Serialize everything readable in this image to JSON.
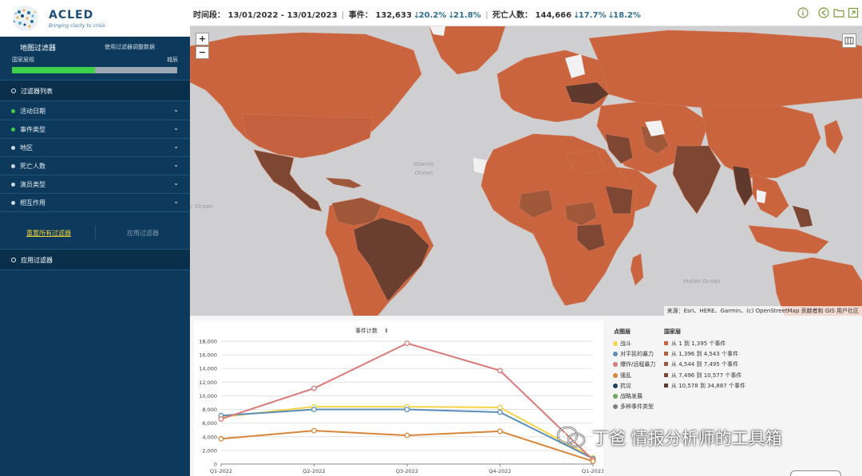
{
  "brand": {
    "name": "ACLED",
    "tagline": "Bringing clarity to crisis"
  },
  "sidebar": {
    "map_filter_title": "地图过滤器",
    "map_filter_use": "使用过滤器调整数据",
    "level_left": "国家层规",
    "level_right": "城辰",
    "level_progress": 0.5,
    "filter_list_title": "过滤器列表",
    "filters": [
      {
        "label": "活动日期",
        "dot_color": "#3ed04a"
      },
      {
        "label": "事件类型",
        "dot_color": "#3ed04a"
      },
      {
        "label": "地区",
        "dot_color": "#cfd9e2"
      },
      {
        "label": "死亡人数",
        "dot_color": "#cfd9e2"
      },
      {
        "label": "演员类型",
        "dot_color": "#cfd9e2"
      },
      {
        "label": "相互作用",
        "dot_color": "#cfd9e2"
      }
    ],
    "reset_label": "重置所有过滤器",
    "apply_label": "应用过滤器",
    "applied_filters_title": "应用过滤器"
  },
  "header": {
    "period_label": "时间段：",
    "period_value": "13/01/2022 - 13/01/2023",
    "events_label": "事件：",
    "events_value": "132,633",
    "events_change_1": "20.2%",
    "events_change_2": "21.8%",
    "deaths_label": "死亡人数：",
    "deaths_value": "144,666",
    "deaths_change_1": "17.7%",
    "deaths_change_2": "18.2%"
  },
  "map": {
    "zoom_in": "+",
    "zoom_out": "−",
    "attribution": "来源：Esri、HERE、Garmin、(c) OpenStreetMap 贡献者和 GIS 用户社区",
    "ocean_labels": [
      "Atlantic Ocean",
      "Indian Ocean",
      "c Ocean"
    ],
    "colors": {
      "ocean": "#cfcfd1",
      "lightest": "#c9643f",
      "light": "#be6440",
      "mid": "#a0583b",
      "dark": "#7e4733",
      "darkest": "#5f3a2c",
      "no_data": "#f1f1f1"
    }
  },
  "legend": {
    "metric_label": "事件计数",
    "point_layer_title": "点图层",
    "point_items": [
      {
        "label": "战斗",
        "color": "#f5d547"
      },
      {
        "label": "对平民的暴力",
        "color": "#5b8fb9"
      },
      {
        "label": "爆炸/远程暴力",
        "color": "#d9797a"
      },
      {
        "label": "骚乱",
        "color": "#d9863b"
      },
      {
        "label": "抗议",
        "color": "#1f3f5e"
      },
      {
        "label": "战略发展",
        "color": "#6ba860"
      },
      {
        "label": "多种事件类型",
        "color": "#7d7d7d"
      }
    ],
    "country_layer_title": "国家层",
    "country_items": [
      {
        "label": "从 1 到 1,395 个事件",
        "color": "#c9643f"
      },
      {
        "label": "从 1,396 到 4,543 个事件",
        "color": "#b35e3e"
      },
      {
        "label": "从 4,544 到 7,495 个事件",
        "color": "#9c5640"
      },
      {
        "label": "从 7,496 到 10,577 个事件",
        "color": "#7e4733"
      },
      {
        "label": "从 10,578 到 34,887 个事件",
        "color": "#5f3a2c"
      }
    ]
  },
  "chart_data": {
    "type": "line",
    "categories": [
      "Q1-2022",
      "Q2-2022",
      "Q3-2022",
      "Q4-2022",
      "Q1-2023"
    ],
    "ylim": [
      0,
      18000
    ],
    "yticks": [
      0,
      2000,
      4000,
      6000,
      8000,
      10000,
      12000,
      14000,
      16000,
      18000
    ],
    "ytick_labels": [
      "0",
      "2,000",
      "4,000",
      "6,000",
      "8,000",
      "10,000",
      "12,000",
      "14,000",
      "16,000",
      "18,000"
    ],
    "grid": true,
    "series": [
      {
        "name": "战斗",
        "color": "#f5d547",
        "values": [
          6900,
          8400,
          8400,
          8300,
          900
        ]
      },
      {
        "name": "对平民的暴力",
        "color": "#5b8fb9",
        "values": [
          7100,
          8000,
          8000,
          7600,
          800
        ]
      },
      {
        "name": "爆炸/远程暴力",
        "color": "#d9797a",
        "values": [
          6600,
          11100,
          17700,
          13700,
          600
        ]
      },
      {
        "name": "骚乱",
        "color": "#d9863b",
        "values": [
          3700,
          4900,
          4200,
          4800,
          400
        ]
      }
    ]
  },
  "watermark": {
    "text": "丁爸 情报分析师的工具箱"
  }
}
